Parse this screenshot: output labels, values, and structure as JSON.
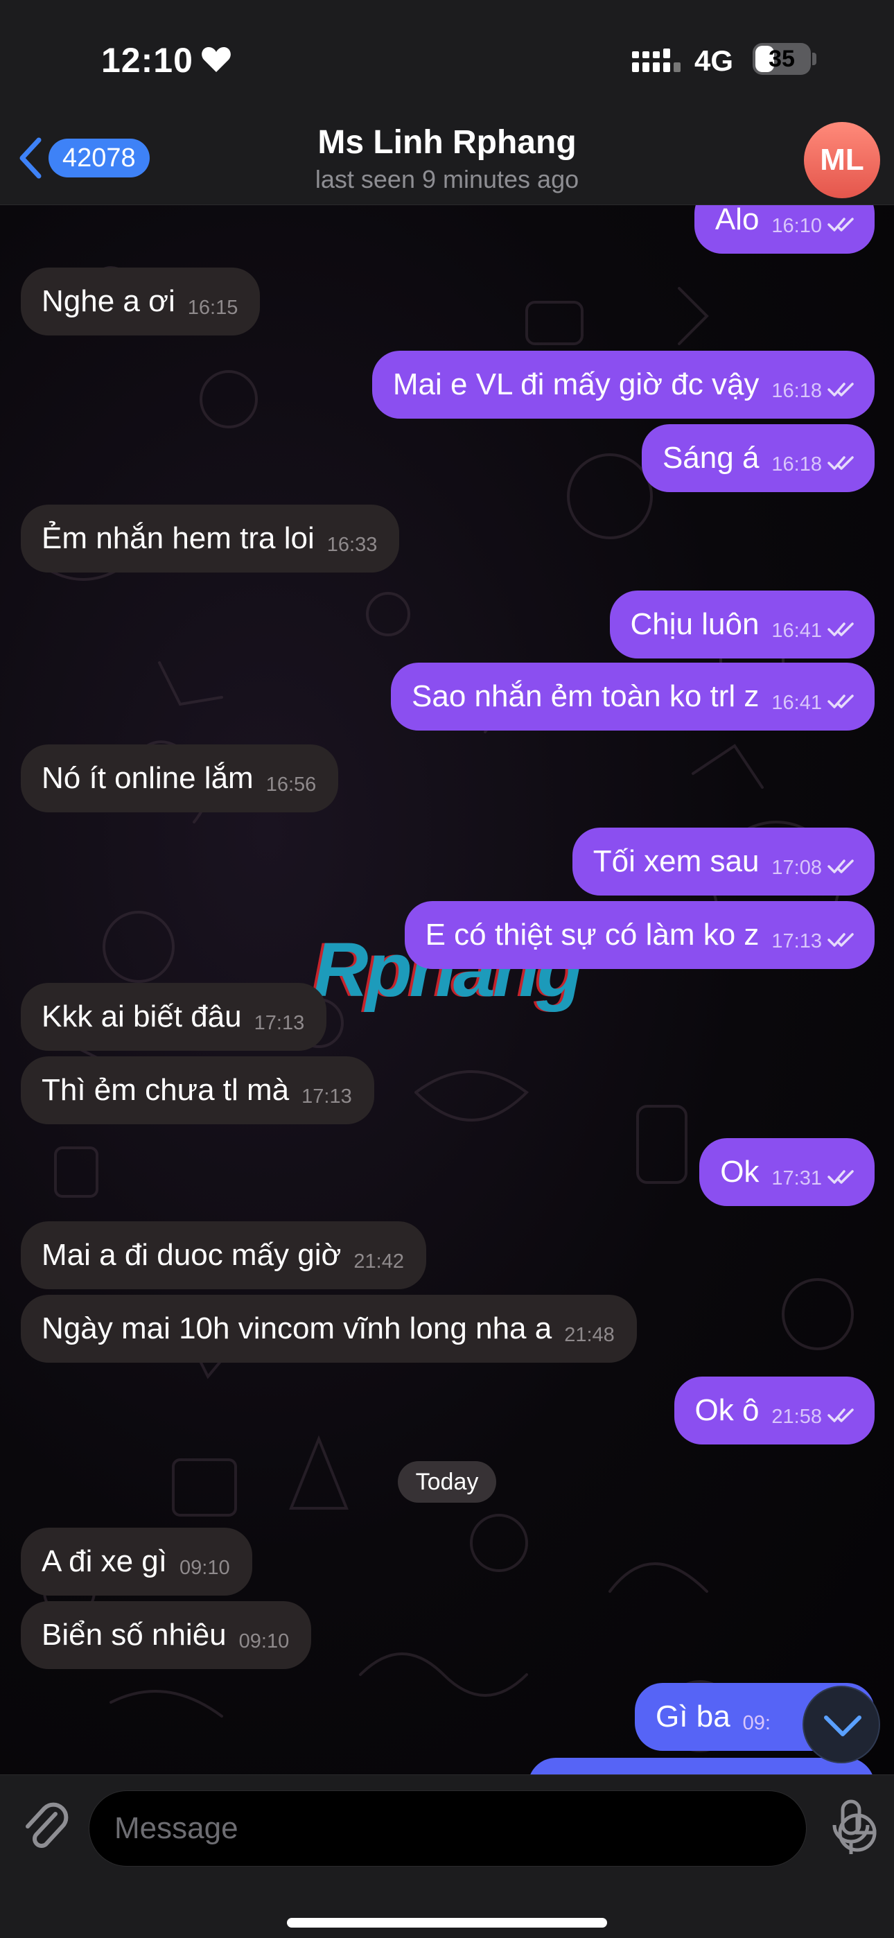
{
  "status_bar": {
    "time": "12:10",
    "network": "4G",
    "battery": "35",
    "battery_level": 0.35
  },
  "header": {
    "back_count": "42078",
    "title": "Ms Linh Rphang",
    "subtitle": "last seen 9 minutes ago",
    "avatar_initials": "ML"
  },
  "messages": [
    {
      "side": "out",
      "text": "Alo",
      "time": "16:10"
    },
    {
      "side": "in",
      "text": "Nghe a ơi",
      "time": "16:15"
    },
    {
      "side": "out",
      "text": "Mai e VL đi mấy giờ đc vậy",
      "time": "16:18"
    },
    {
      "side": "out",
      "text": "Sáng á",
      "time": "16:18"
    },
    {
      "side": "in",
      "text": "Ẻm nhắn hem tra loi",
      "time": "16:33"
    },
    {
      "side": "out",
      "text": "Chịu luôn",
      "time": "16:41"
    },
    {
      "side": "out",
      "text": "Sao nhắn ẻm toàn ko trl z",
      "time": "16:41"
    },
    {
      "side": "in",
      "text": "Nó ít online lắm",
      "time": "16:56"
    },
    {
      "side": "out",
      "text": "Tối xem sau",
      "time": "17:08"
    },
    {
      "side": "out",
      "text": "E có thiệt sự có làm ko z",
      "time": "17:13"
    },
    {
      "side": "in",
      "text": "Kkk ai biết đâu",
      "time": "17:13"
    },
    {
      "side": "in",
      "text": "Thì ẻm chưa tl mà",
      "time": "17:13"
    },
    {
      "side": "out",
      "text": "Ok",
      "time": "17:31"
    },
    {
      "side": "in",
      "text": "Mai a đi duoc mấy giờ",
      "time": "21:42"
    },
    {
      "side": "in",
      "text": "Ngày mai 10h vincom vĩnh long nha a",
      "time": "21:48"
    },
    {
      "side": "out",
      "text": "Ok ô",
      "time": "21:58"
    },
    {
      "side": "in",
      "text": "A đi xe gì",
      "time": "09:10"
    },
    {
      "side": "in",
      "text": "Biển số nhiêu",
      "time": "09:10"
    },
    {
      "side": "out",
      "text": "Gì ba",
      "time": "09:"
    }
  ],
  "date_divider": "Today",
  "watermark": "Rphang",
  "composer": {
    "placeholder": "Message"
  },
  "colors": {
    "outgoing": "#8b4ff0",
    "outgoing_latest": "#5664f6",
    "incoming": "#2a2526",
    "badge": "#3e82f7"
  },
  "icons": [
    "heart-icon",
    "signal-icon",
    "back-icon",
    "read-checks-icon",
    "chevron-down-icon",
    "attach-icon",
    "sticker-icon",
    "mic-icon"
  ]
}
